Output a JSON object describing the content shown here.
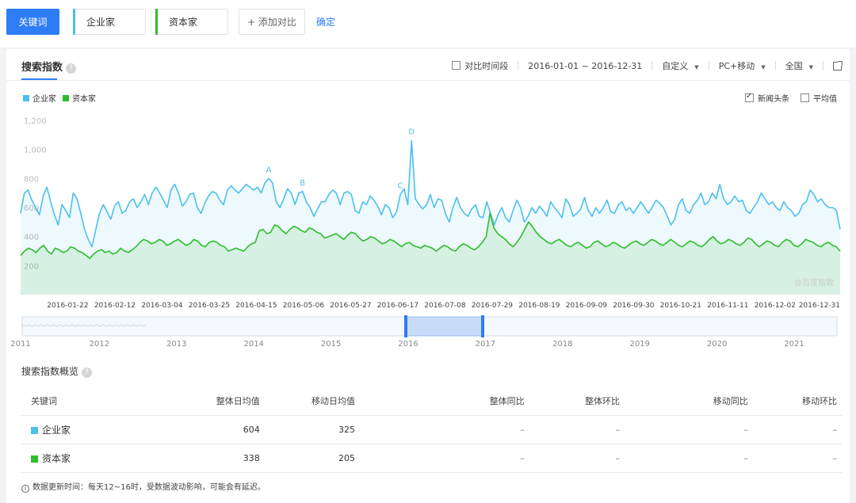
{
  "topbar": {
    "keyword_tab": "关键词",
    "keywords": [
      {
        "label": "企业家",
        "color": "#4bc0ee"
      },
      {
        "label": "资本家",
        "color": "#2fbd2c"
      }
    ],
    "add_compare": "+ 添加对比",
    "confirm": "确定"
  },
  "panel": {
    "title": "搜索指数",
    "help": "?",
    "controls": {
      "compare_period": "对比时间段",
      "date_range": "2016-01-01 ~ 2016-12-31",
      "custom": "自定义",
      "device": "PC+移动",
      "region": "全国"
    },
    "legend": [
      {
        "label": "企业家",
        "color": "#4bc0ee"
      },
      {
        "label": "资本家",
        "color": "#2fbd2c"
      }
    ],
    "options": {
      "news": "新闻头条",
      "news_checked": true,
      "average": "平均值",
      "average_checked": false
    },
    "watermark": "@百度指数"
  },
  "chart_data": {
    "type": "area",
    "ylim": [
      0,
      1200
    ],
    "yticks": [
      "1,200",
      "1,000",
      "800",
      "600",
      "400",
      "200"
    ],
    "x_tick_labels": [
      "2016-01-22",
      "2016-02-12",
      "2016-03-04",
      "2016-03-25",
      "2016-04-15",
      "2016-05-06",
      "2016-05-27",
      "2016-06-17",
      "2016-07-08",
      "2016-07-29",
      "2016-08-19",
      "2016-09-09",
      "2016-09-30",
      "2016-10-21",
      "2016-11-11",
      "2016-12-02",
      "2016-12-31"
    ],
    "x_start": "2016-01-01",
    "x_end": "2016-12-31",
    "series": [
      {
        "name": "企业家",
        "color": "#4bc0ee",
        "values": [
          560,
          700,
          720,
          650,
          600,
          550,
          680,
          740,
          640,
          550,
          480,
          620,
          580,
          530,
          700,
          660,
          560,
          450,
          380,
          330,
          450,
          560,
          620,
          570,
          520,
          610,
          640,
          560,
          580,
          640,
          660,
          600,
          640,
          690,
          620,
          700,
          740,
          700,
          650,
          600,
          720,
          760,
          700,
          610,
          640,
          690,
          700,
          600,
          560,
          630,
          680,
          710,
          700,
          650,
          620,
          720,
          750,
          720,
          700,
          730,
          760,
          740,
          720,
          740,
          700,
          770,
          800,
          770,
          640,
          600,
          660,
          730,
          700,
          620,
          700,
          710,
          640,
          600,
          540,
          590,
          640,
          640,
          690,
          720,
          700,
          620,
          700,
          710,
          690,
          580,
          560,
          640,
          620,
          680,
          650,
          610,
          550,
          620,
          600,
          530,
          570,
          690,
          730,
          620,
          1060,
          660,
          620,
          590,
          620,
          690,
          600,
          660,
          650,
          560,
          500,
          600,
          670,
          600,
          560,
          540,
          590,
          620,
          540,
          530,
          640,
          560,
          480,
          550,
          600,
          530,
          500,
          580,
          650,
          600,
          500,
          540,
          600,
          560,
          610,
          580,
          540,
          640,
          600,
          570,
          530,
          660,
          620,
          540,
          560,
          590,
          670,
          580,
          540,
          600,
          560,
          600,
          650,
          570,
          560,
          620,
          640,
          580,
          600,
          560,
          600,
          640,
          600,
          560,
          600,
          650,
          630,
          600,
          540,
          480,
          520,
          620,
          660,
          580,
          560,
          620,
          650,
          700,
          620,
          640,
          700,
          660,
          760,
          660,
          620,
          640,
          680,
          640,
          650,
          580,
          560,
          600,
          640,
          700,
          660,
          620,
          640,
          600,
          580,
          640,
          600,
          580,
          540,
          560,
          620,
          640,
          720,
          690,
          640,
          660,
          620,
          600,
          600,
          580,
          450
        ]
      },
      {
        "name": "资本家",
        "color": "#2fbd2c",
        "values": [
          270,
          300,
          320,
          310,
          290,
          320,
          340,
          300,
          280,
          320,
          310,
          290,
          300,
          330,
          320,
          300,
          290,
          270,
          250,
          280,
          300,
          310,
          290,
          300,
          280,
          290,
          320,
          300,
          290,
          310,
          330,
          360,
          380,
          370,
          350,
          360,
          380,
          370,
          340,
          350,
          370,
          380,
          360,
          340,
          350,
          380,
          370,
          340,
          330,
          360,
          370,
          360,
          340,
          330,
          300,
          310,
          320,
          310,
          300,
          330,
          350,
          360,
          440,
          450,
          420,
          430,
          480,
          470,
          440,
          420,
          450,
          470,
          460,
          440,
          430,
          460,
          450,
          430,
          420,
          390,
          400,
          410,
          420,
          400,
          380,
          410,
          430,
          420,
          390,
          370,
          380,
          400,
          390,
          370,
          350,
          360,
          380,
          370,
          350,
          330,
          350,
          360,
          340,
          330,
          320,
          340,
          330,
          320,
          300,
          320,
          340,
          330,
          310,
          300,
          330,
          350,
          340,
          320,
          310,
          330,
          360,
          400,
          560,
          460,
          420,
          400,
          380,
          350,
          330,
          360,
          400,
          450,
          500,
          470,
          430,
          400,
          380,
          360,
          350,
          370,
          380,
          360,
          340,
          330,
          350,
          360,
          340,
          320,
          330,
          360,
          370,
          350,
          330,
          340,
          360,
          350,
          330,
          320,
          340,
          360,
          370,
          350,
          340,
          360,
          380,
          370,
          350,
          340,
          360,
          380,
          360,
          340,
          330,
          350,
          370,
          360,
          340,
          330,
          350,
          380,
          400,
          370,
          350,
          360,
          380,
          370,
          350,
          340,
          360,
          390,
          380,
          350,
          330,
          350,
          370,
          360,
          340,
          330,
          360,
          380,
          370,
          340,
          330,
          350,
          380,
          370,
          360,
          340,
          330,
          350,
          360,
          340,
          330,
          300
        ]
      }
    ],
    "annotations": [
      "A",
      "B",
      "C",
      "D"
    ],
    "navigator_years": [
      "2011",
      "2012",
      "2013",
      "2014",
      "2015",
      "2016",
      "2017",
      "2018",
      "2019",
      "2020",
      "2021"
    ]
  },
  "overview": {
    "title": "搜索指数概览",
    "headers": [
      "关键词",
      "整体日均值",
      "移动日均值",
      "整体同比",
      "整体环比",
      "移动同比",
      "移动环比"
    ],
    "rows": [
      {
        "keyword": "企业家",
        "color": "#4bc0ee",
        "overall": "604",
        "mobile": "325",
        "yoy": "–",
        "mom": "–",
        "m_yoy": "–",
        "m_mom": "–"
      },
      {
        "keyword": "资本家",
        "color": "#2fbd2c",
        "overall": "338",
        "mobile": "205",
        "yoy": "–",
        "mom": "–",
        "m_yoy": "–",
        "m_mom": "–"
      }
    ],
    "footnote": "数据更新时间：每天12~16时，受数据波动影响，可能会有延迟。",
    "info": "i"
  }
}
